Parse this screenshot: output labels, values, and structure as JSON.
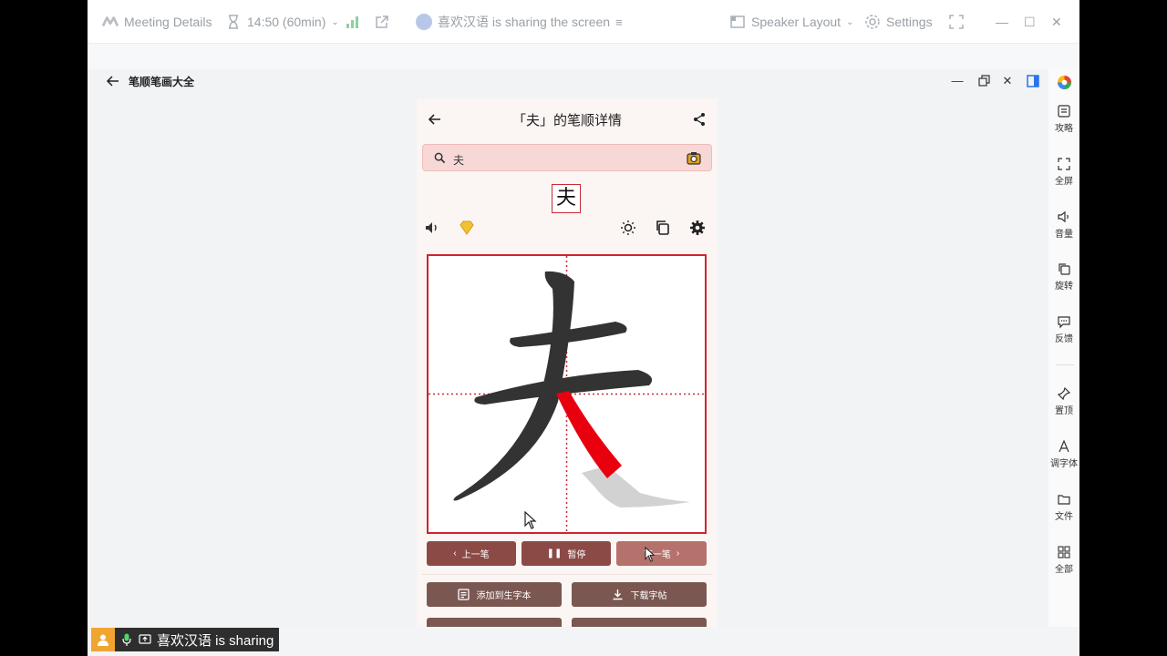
{
  "meeting_bar": {
    "details_label": "Meeting Details",
    "time_label": "14:50 (60min)",
    "sharing_label": "喜欢汉语 is sharing the screen",
    "layout_label": "Speaker Layout",
    "settings_label": "Settings"
  },
  "app": {
    "title": "笔顺笔画大全"
  },
  "right_bar": {
    "items": [
      {
        "label": "攻略",
        "icon": "guide-icon"
      },
      {
        "label": "全屏",
        "icon": "fullscreen-icon"
      },
      {
        "label": "音量",
        "icon": "volume-icon"
      },
      {
        "label": "旋转",
        "icon": "rotate-icon"
      },
      {
        "label": "反馈",
        "icon": "feedback-icon"
      },
      {
        "label": "置顶",
        "icon": "pin-icon"
      },
      {
        "label": "调字体",
        "icon": "font-icon"
      },
      {
        "label": "文件",
        "icon": "folder-icon"
      },
      {
        "label": "全部",
        "icon": "grid-icon"
      }
    ]
  },
  "phone": {
    "title": "「夫」的笔顺详情",
    "search_value": "夫",
    "character": "夫",
    "controls": {
      "prev": "上一笔",
      "pause": "暂停",
      "next": "下一笔"
    },
    "actions": {
      "add": "添加到生字本",
      "download": "下载字帖"
    }
  },
  "share_badge": {
    "text": "喜欢汉语 is sharing"
  },
  "colors": {
    "accent_red": "#d0232f",
    "button_brown": "#8c4a46",
    "stroke_highlight": "#e8000f"
  }
}
